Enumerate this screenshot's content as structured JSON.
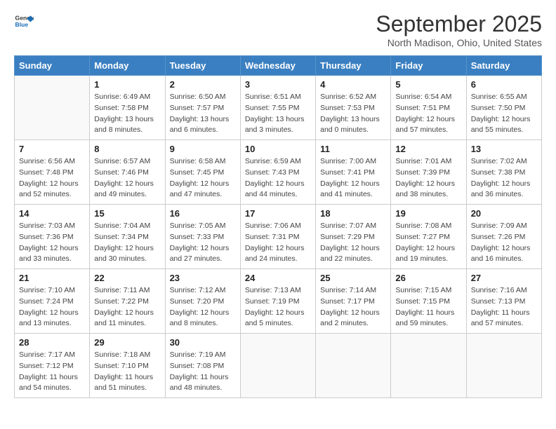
{
  "header": {
    "logo_line1": "General",
    "logo_line2": "Blue",
    "month": "September 2025",
    "location": "North Madison, Ohio, United States"
  },
  "days_of_week": [
    "Sunday",
    "Monday",
    "Tuesday",
    "Wednesday",
    "Thursday",
    "Friday",
    "Saturday"
  ],
  "weeks": [
    [
      {
        "day": "",
        "sunrise": "",
        "sunset": "",
        "daylight": ""
      },
      {
        "day": "1",
        "sunrise": "Sunrise: 6:49 AM",
        "sunset": "Sunset: 7:58 PM",
        "daylight": "Daylight: 13 hours and 8 minutes."
      },
      {
        "day": "2",
        "sunrise": "Sunrise: 6:50 AM",
        "sunset": "Sunset: 7:57 PM",
        "daylight": "Daylight: 13 hours and 6 minutes."
      },
      {
        "day": "3",
        "sunrise": "Sunrise: 6:51 AM",
        "sunset": "Sunset: 7:55 PM",
        "daylight": "Daylight: 13 hours and 3 minutes."
      },
      {
        "day": "4",
        "sunrise": "Sunrise: 6:52 AM",
        "sunset": "Sunset: 7:53 PM",
        "daylight": "Daylight: 13 hours and 0 minutes."
      },
      {
        "day": "5",
        "sunrise": "Sunrise: 6:54 AM",
        "sunset": "Sunset: 7:51 PM",
        "daylight": "Daylight: 12 hours and 57 minutes."
      },
      {
        "day": "6",
        "sunrise": "Sunrise: 6:55 AM",
        "sunset": "Sunset: 7:50 PM",
        "daylight": "Daylight: 12 hours and 55 minutes."
      }
    ],
    [
      {
        "day": "7",
        "sunrise": "Sunrise: 6:56 AM",
        "sunset": "Sunset: 7:48 PM",
        "daylight": "Daylight: 12 hours and 52 minutes."
      },
      {
        "day": "8",
        "sunrise": "Sunrise: 6:57 AM",
        "sunset": "Sunset: 7:46 PM",
        "daylight": "Daylight: 12 hours and 49 minutes."
      },
      {
        "day": "9",
        "sunrise": "Sunrise: 6:58 AM",
        "sunset": "Sunset: 7:45 PM",
        "daylight": "Daylight: 12 hours and 47 minutes."
      },
      {
        "day": "10",
        "sunrise": "Sunrise: 6:59 AM",
        "sunset": "Sunset: 7:43 PM",
        "daylight": "Daylight: 12 hours and 44 minutes."
      },
      {
        "day": "11",
        "sunrise": "Sunrise: 7:00 AM",
        "sunset": "Sunset: 7:41 PM",
        "daylight": "Daylight: 12 hours and 41 minutes."
      },
      {
        "day": "12",
        "sunrise": "Sunrise: 7:01 AM",
        "sunset": "Sunset: 7:39 PM",
        "daylight": "Daylight: 12 hours and 38 minutes."
      },
      {
        "day": "13",
        "sunrise": "Sunrise: 7:02 AM",
        "sunset": "Sunset: 7:38 PM",
        "daylight": "Daylight: 12 hours and 36 minutes."
      }
    ],
    [
      {
        "day": "14",
        "sunrise": "Sunrise: 7:03 AM",
        "sunset": "Sunset: 7:36 PM",
        "daylight": "Daylight: 12 hours and 33 minutes."
      },
      {
        "day": "15",
        "sunrise": "Sunrise: 7:04 AM",
        "sunset": "Sunset: 7:34 PM",
        "daylight": "Daylight: 12 hours and 30 minutes."
      },
      {
        "day": "16",
        "sunrise": "Sunrise: 7:05 AM",
        "sunset": "Sunset: 7:33 PM",
        "daylight": "Daylight: 12 hours and 27 minutes."
      },
      {
        "day": "17",
        "sunrise": "Sunrise: 7:06 AM",
        "sunset": "Sunset: 7:31 PM",
        "daylight": "Daylight: 12 hours and 24 minutes."
      },
      {
        "day": "18",
        "sunrise": "Sunrise: 7:07 AM",
        "sunset": "Sunset: 7:29 PM",
        "daylight": "Daylight: 12 hours and 22 minutes."
      },
      {
        "day": "19",
        "sunrise": "Sunrise: 7:08 AM",
        "sunset": "Sunset: 7:27 PM",
        "daylight": "Daylight: 12 hours and 19 minutes."
      },
      {
        "day": "20",
        "sunrise": "Sunrise: 7:09 AM",
        "sunset": "Sunset: 7:26 PM",
        "daylight": "Daylight: 12 hours and 16 minutes."
      }
    ],
    [
      {
        "day": "21",
        "sunrise": "Sunrise: 7:10 AM",
        "sunset": "Sunset: 7:24 PM",
        "daylight": "Daylight: 12 hours and 13 minutes."
      },
      {
        "day": "22",
        "sunrise": "Sunrise: 7:11 AM",
        "sunset": "Sunset: 7:22 PM",
        "daylight": "Daylight: 12 hours and 11 minutes."
      },
      {
        "day": "23",
        "sunrise": "Sunrise: 7:12 AM",
        "sunset": "Sunset: 7:20 PM",
        "daylight": "Daylight: 12 hours and 8 minutes."
      },
      {
        "day": "24",
        "sunrise": "Sunrise: 7:13 AM",
        "sunset": "Sunset: 7:19 PM",
        "daylight": "Daylight: 12 hours and 5 minutes."
      },
      {
        "day": "25",
        "sunrise": "Sunrise: 7:14 AM",
        "sunset": "Sunset: 7:17 PM",
        "daylight": "Daylight: 12 hours and 2 minutes."
      },
      {
        "day": "26",
        "sunrise": "Sunrise: 7:15 AM",
        "sunset": "Sunset: 7:15 PM",
        "daylight": "Daylight: 11 hours and 59 minutes."
      },
      {
        "day": "27",
        "sunrise": "Sunrise: 7:16 AM",
        "sunset": "Sunset: 7:13 PM",
        "daylight": "Daylight: 11 hours and 57 minutes."
      }
    ],
    [
      {
        "day": "28",
        "sunrise": "Sunrise: 7:17 AM",
        "sunset": "Sunset: 7:12 PM",
        "daylight": "Daylight: 11 hours and 54 minutes."
      },
      {
        "day": "29",
        "sunrise": "Sunrise: 7:18 AM",
        "sunset": "Sunset: 7:10 PM",
        "daylight": "Daylight: 11 hours and 51 minutes."
      },
      {
        "day": "30",
        "sunrise": "Sunrise: 7:19 AM",
        "sunset": "Sunset: 7:08 PM",
        "daylight": "Daylight: 11 hours and 48 minutes."
      },
      {
        "day": "",
        "sunrise": "",
        "sunset": "",
        "daylight": ""
      },
      {
        "day": "",
        "sunrise": "",
        "sunset": "",
        "daylight": ""
      },
      {
        "day": "",
        "sunrise": "",
        "sunset": "",
        "daylight": ""
      },
      {
        "day": "",
        "sunrise": "",
        "sunset": "",
        "daylight": ""
      }
    ]
  ]
}
